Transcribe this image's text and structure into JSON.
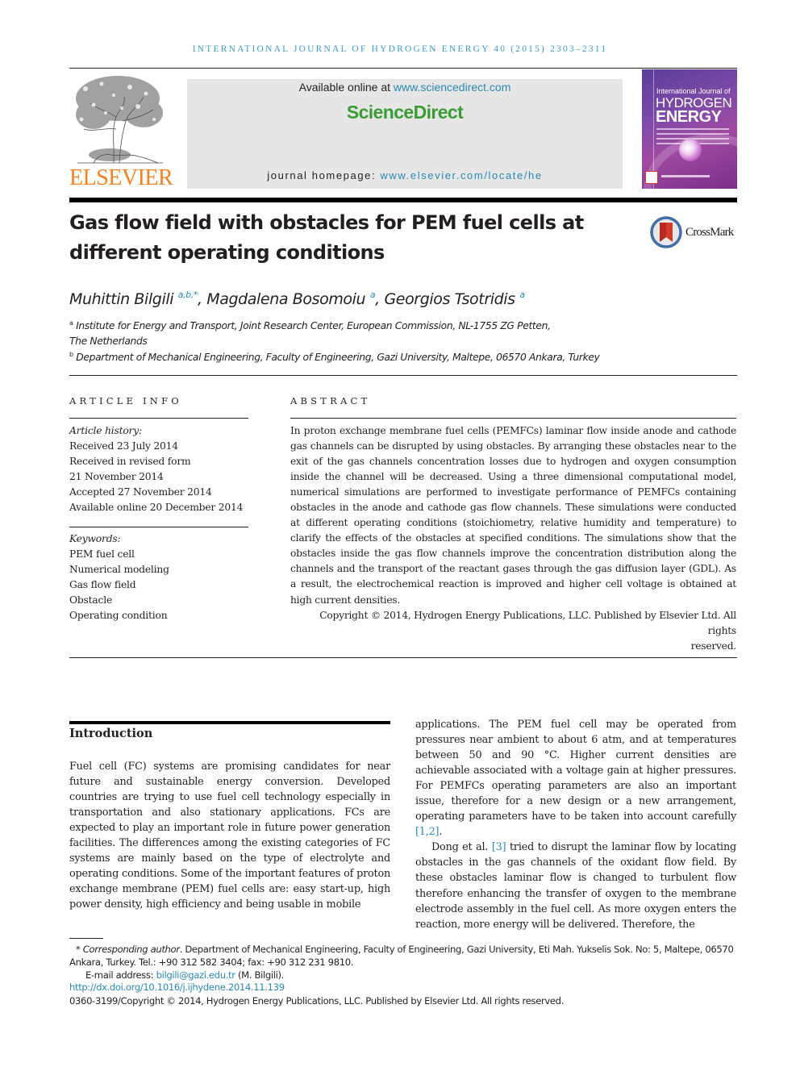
{
  "journal": {
    "running_head": "INTERNATIONAL JOURNAL OF HYDROGEN ENERGY 40 (2015) 2303–2311",
    "publisher_logo_text": "ELSEVIER",
    "available_online_prefix": "Available online at ",
    "available_online_link": "www.sciencedirect.com",
    "brand": "ScienceDirect",
    "homepage_prefix": "journal homepage: ",
    "homepage_link": "www.elsevier.com/locate/he",
    "cover": {
      "line1": "International Journal of",
      "line2": "HYDROGEN",
      "line3": "ENERGY"
    },
    "colors": {
      "link": "#2a8ab7",
      "running_head": "#3d9dc8",
      "elsevier_orange": "#f58220",
      "sciencedirect_green": "#3a9c35",
      "header_box": "#e6e6e6"
    }
  },
  "article": {
    "title_line1": "Gas flow field with obstacles for PEM fuel cells at",
    "title_line2": "different operating conditions",
    "crossmark_label": "CrossMark",
    "authors": [
      {
        "name": "Muhittin Bilgili",
        "sup": "a,b,*",
        "sep": ", "
      },
      {
        "name": "Magdalena Bosomoiu",
        "sup": "a",
        "sep": ", "
      },
      {
        "name": "Georgios Tsotridis",
        "sup": "a",
        "sep": ""
      }
    ],
    "affiliations": [
      {
        "mark": "a",
        "line1": "Institute for Energy and Transport, Joint Research Center, European Commission, NL-1755 ZG Petten,",
        "line2": "The Netherlands"
      },
      {
        "mark": "b",
        "line1": "Department of Mechanical Engineering, Faculty of Engineering, Gazi University, Maltepe, 06570 Ankara, Turkey"
      }
    ]
  },
  "article_info": {
    "heading": "ARTICLE INFO",
    "history_label": "Article history:",
    "history": [
      "Received 23 July 2014",
      "Received in revised form",
      "21 November 2014",
      "Accepted 27 November 2014",
      "Available online 20 December 2014"
    ],
    "keywords_label": "Keywords:",
    "keywords": [
      "PEM fuel cell",
      "Numerical modeling",
      "Gas flow field",
      "Obstacle",
      "Operating condition"
    ]
  },
  "abstract": {
    "heading": "ABSTRACT",
    "text": "In proton exchange membrane fuel cells (PEMFCs) laminar flow inside anode and cathode gas channels can be disrupted by using obstacles. By arranging these obstacles near to the exit of the gas channels concentration losses due to hydrogen and oxygen consumption inside the channel will be decreased. Using a three dimensional computational model, numerical simulations are performed to investigate performance of PEMFCs containing obstacles in the anode and cathode gas flow channels. These simulations were conducted at different operating conditions (stoichiometry, relative humidity and temperature) to clarify the effects of the obstacles at specified conditions. The simulations show that the obstacles inside the gas flow channels improve the concentration distribution along the channels and the transport of the reactant gases through the gas diffusion layer (GDL). As a result, the electrochemical reaction is improved and higher cell voltage is obtained at high current densities.",
    "copyright_line1": "Copyright © 2014, Hydrogen Energy Publications, LLC. Published by Elsevier Ltd. All rights",
    "copyright_line2": "reserved."
  },
  "introduction": {
    "heading": "Introduction",
    "left_paragraph": "Fuel cell (FC) systems are promising candidates for near future and sustainable energy conversion. Developed countries are trying to use fuel cell technology especially in transportation and also stationary applications. FCs are expected to play an important role in future power generation facilities. The differences among the existing categories of FC systems are mainly based on the type of electrolyte and operating conditions. Some of the important features of proton exchange membrane (PEM) fuel cells are: easy start-up, high power density, high efficiency and being usable in mobile",
    "right_p1_text": "applications. The PEM fuel cell may be operated from pressures near ambient to about 6 atm, and at temperatures between 50 and 90 °C. Higher current densities are achievable associated with a voltage gain at higher pressures. For PEMFCs operating parameters are also an important issue, therefore for a new design or a new arrangement, operating parameters have to be taken into account carefully ",
    "right_p1_ref": "[1,2]",
    "right_p1_end": ".",
    "right_p2_start": "Dong et al. ",
    "right_p2_ref": "[3]",
    "right_p2_text": " tried to disrupt the laminar flow by locating obstacles in the gas channels of the oxidant flow field. By these obstacles laminar flow is changed to turbulent flow therefore enhancing the transfer of oxygen to the membrane electrode assembly in the fuel cell. As more oxygen enters the reaction, more energy will be delivered. Therefore, the"
  },
  "footnotes": {
    "corresponding_mark": "*",
    "corresponding_label": "Corresponding author",
    "corresponding_text": ". Department of Mechanical Engineering, Faculty of Engineering, Gazi University, Eti Mah. Yukselis Sok. No: 5, Maltepe, 06570 Ankara, Turkey. Tel.: +90 312 582 3404; fax: +90 312 231 9810.",
    "email_label": "E-mail address: ",
    "email": "bilgili@gazi.edu.tr",
    "email_suffix": " (M. Bilgili).",
    "doi": "http://dx.doi.org/10.1016/j.ijhydene.2014.11.139",
    "issn_copyright": "0360-3199/Copyright © 2014, Hydrogen Energy Publications, LLC. Published by Elsevier Ltd. All rights reserved."
  }
}
